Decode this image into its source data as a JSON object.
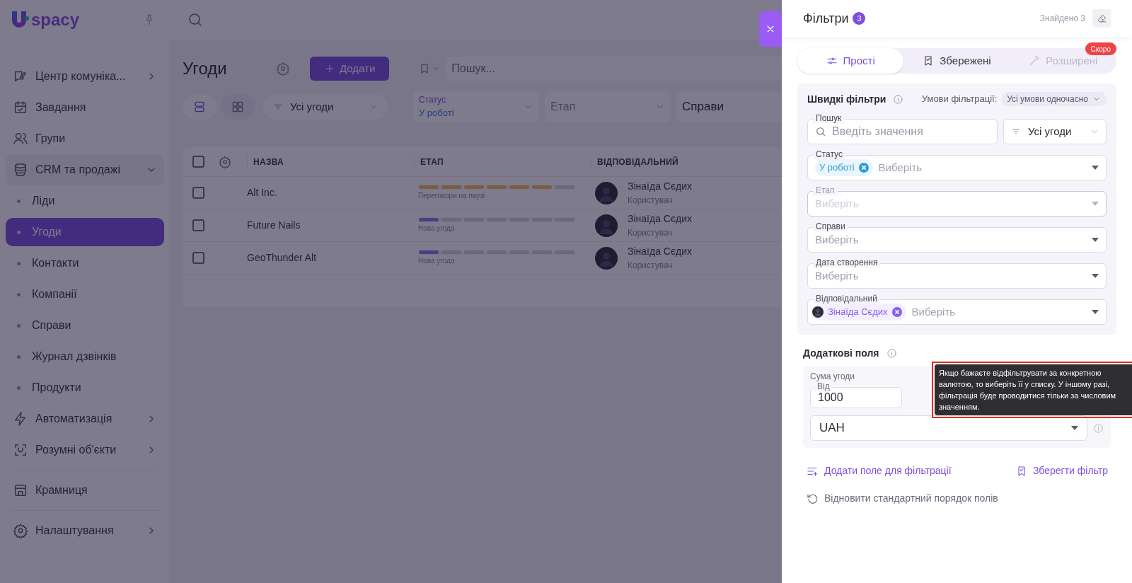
{
  "sidebar": {
    "logo": "spacy",
    "items": [
      {
        "label": "Центр комуніка...",
        "expanded": false
      },
      {
        "label": "Завдання"
      },
      {
        "label": "Групи"
      },
      {
        "label": "CRM та продажі",
        "expanded": true,
        "children": [
          {
            "label": "Ліди",
            "selected": false
          },
          {
            "label": "Угоди",
            "selected": true
          },
          {
            "label": "Контакти",
            "selected": false
          },
          {
            "label": "Компанії",
            "selected": false
          },
          {
            "label": "Справи",
            "selected": false
          },
          {
            "label": "Журнал дзвінків",
            "selected": false
          },
          {
            "label": "Продукти",
            "selected": false
          }
        ]
      },
      {
        "label": "Автоматизація",
        "expanded": false
      },
      {
        "label": "Розумні об'єкти",
        "expanded": false
      },
      {
        "label": "Крамниця"
      },
      {
        "label": "Налаштування",
        "expanded": false
      }
    ]
  },
  "main": {
    "title": "Угоди",
    "add_button": "Додати",
    "search": {
      "placeholder": "Пошук..."
    },
    "views": [
      {
        "selected": true
      },
      {
        "selected": false
      }
    ],
    "deal_filter": "Усі угоди",
    "filters": [
      {
        "label": "Статус",
        "value": "У роботі"
      },
      {
        "placeholder": "Етап"
      },
      {
        "value": "Справи"
      }
    ],
    "table": {
      "select_all": {
        "checked": false
      },
      "columns": [
        "НАЗВА",
        "ЕТАП",
        "ВІДПОВІДАЛЬНИЙ"
      ],
      "rows": [
        {
          "checked": false,
          "name": "Alt Inc.",
          "stage": "Переговори на паузі",
          "level": 0.86,
          "color": "#785f3c",
          "person": "Зінаїда Сєдих",
          "role": "Користувач"
        },
        {
          "checked": false,
          "name": "Future Nails",
          "stage": "Нова угода",
          "level": 0.14,
          "color": "#503c82",
          "person": "Зінаїда Сєдих",
          "role": "Користувач"
        },
        {
          "checked": false,
          "name": "GeoThunder Alt",
          "stage": "Нова угода",
          "level": 0.14,
          "color": "#503c82",
          "person": "Зінаїда Сєдих",
          "role": "Користувач"
        }
      ]
    }
  },
  "panel": {
    "title": "Фільтри",
    "count": "3",
    "found": "Знайдено 3",
    "tabs": [
      {
        "label": "Прості",
        "selected": true,
        "disabled": false
      },
      {
        "label": "Збережені",
        "selected": false,
        "disabled": false
      },
      {
        "label": "Розширені",
        "selected": false,
        "disabled": true,
        "badge": "Скоро"
      }
    ],
    "quick": {
      "title": "Швидкі фільтри",
      "conditions_label": "Умови фільтрації:",
      "conditions_value": "Усі умови одночасно",
      "search": {
        "label": "Пошук",
        "placeholder": "Введіть значення"
      },
      "deal_filter": "Усі угоди",
      "fields": [
        {
          "label": "Статус",
          "chips": [
            {
              "kind": "status",
              "text": "У роботі"
            }
          ],
          "placeholder": "Виберіть",
          "disabled": false
        },
        {
          "label": "Етап",
          "placeholder": "Виберіть",
          "disabled": true
        },
        {
          "label": "Справи",
          "placeholder": "Виберіть",
          "disabled": false
        },
        {
          "label": "Дата створення",
          "placeholder": "Виберіть",
          "disabled": false
        },
        {
          "label": "Відповідальний",
          "chips": [
            {
              "kind": "person",
              "text": "Зінаїда Сєдих"
            }
          ],
          "placeholder": "Виберіть",
          "disabled": false
        }
      ]
    },
    "extra": {
      "title": "Додаткові поля",
      "group_label": "Сума угоди",
      "from": {
        "label": "Від",
        "value": "1000"
      },
      "currency": "UAH",
      "tooltip": "Якщо бажаєте відфільтрувати за конкретною валютою, то виберіть її у списку. У іншому разі, фільтрація буде проводитися тільки за числовим значенням."
    },
    "actions": {
      "add_field": "Додати поле для фільтрації",
      "save": "Зберегти фільтр",
      "reset": "Відновити стандартний порядок полів"
    }
  }
}
